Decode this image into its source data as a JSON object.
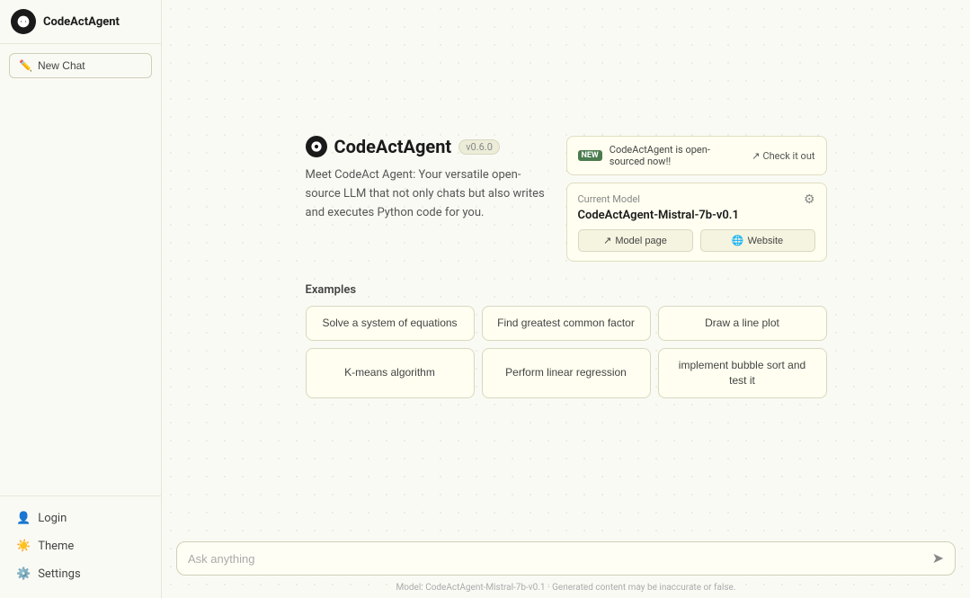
{
  "sidebar": {
    "brand": "CodeActAgent",
    "new_chat_label": "New Chat",
    "bottom_items": [
      {
        "id": "login",
        "label": "Login",
        "icon": "user-icon"
      },
      {
        "id": "theme",
        "label": "Theme",
        "icon": "sun-icon"
      },
      {
        "id": "settings",
        "label": "Settings",
        "icon": "settings-icon"
      }
    ]
  },
  "main": {
    "app_title": "CodeActAgent",
    "app_version": "v0.6.0",
    "app_description": "Meet CodeAct Agent: Your versatile open-source LLM that not only chats but also writes and executes Python code for you.",
    "announcement": {
      "new_badge": "NEW",
      "text": "CodeActAgent is open-sourced now!!",
      "link_label": "Check it out",
      "link_arrow": "↗"
    },
    "current_model": {
      "label": "Current Model",
      "name": "CodeActAgent-Mistral-7b-v0.1",
      "links": [
        {
          "id": "model-page",
          "label": "Model page",
          "icon": "↗"
        },
        {
          "id": "website",
          "label": "Website",
          "icon": "🌐"
        }
      ]
    },
    "examples": {
      "title": "Examples",
      "items": [
        "Solve a system of equations",
        "Find greatest common factor",
        "Draw a line plot",
        "K-means algorithm",
        "Perform linear regression",
        "implement bubble sort and test it"
      ]
    },
    "input": {
      "placeholder": "Ask anything",
      "send_icon": "➤"
    },
    "footer": "Model: CodeActAgent-Mistral-7b-v0.1 · Generated content may be inaccurate or false."
  }
}
